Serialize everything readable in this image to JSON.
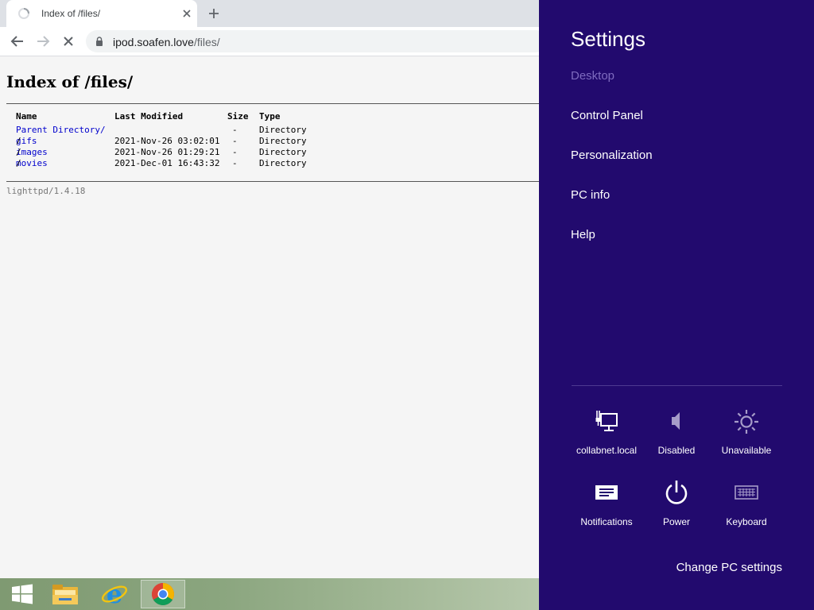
{
  "browser": {
    "tab": {
      "title": "Index of /files/"
    },
    "address": {
      "host": "ipod.soafen.love",
      "path": "/files/"
    }
  },
  "page": {
    "title": "Index of /files/",
    "headers": {
      "name": "Name",
      "modified": "Last Modified",
      "size": "Size",
      "type": "Type"
    },
    "rows": [
      {
        "name": "Parent Directory/",
        "modified": "",
        "size": "-",
        "type": "Directory"
      },
      {
        "name": "gifs",
        "modified": "2021-Nov-26 03:02:01",
        "size": "-",
        "type": "Directory"
      },
      {
        "name": "images",
        "modified": "2021-Nov-26 01:29:21",
        "size": "-",
        "type": "Directory"
      },
      {
        "name": "movies",
        "modified": "2021-Dec-01 16:43:32",
        "size": "-",
        "type": "Directory"
      }
    ],
    "slash": "/",
    "footer": "lighttpd/1.4.18"
  },
  "taskbar": {
    "items": [
      "start-icon",
      "file-explorer-icon",
      "internet-explorer-icon",
      "chrome-icon"
    ]
  },
  "settings": {
    "title": "Settings",
    "links": {
      "desktop": "Desktop",
      "control_panel": "Control Panel",
      "personalization": "Personalization",
      "pc_info": "PC info",
      "help": "Help"
    },
    "tiles": {
      "network": "collabnet.local",
      "volume": "Disabled",
      "brightness": "Unavailable",
      "notifications": "Notifications",
      "power": "Power",
      "keyboard": "Keyboard"
    },
    "change_pc_settings": "Change PC settings"
  },
  "colors": {
    "charm_bg": "#220a6e",
    "charm_muted": "#7e6bbf",
    "link": "#0000cc"
  }
}
